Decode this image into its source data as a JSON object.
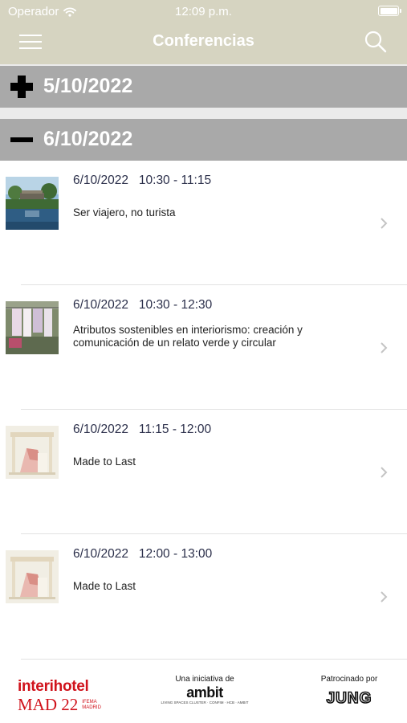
{
  "status_bar": {
    "carrier": "Operador",
    "time": "12:09 p.m."
  },
  "nav": {
    "title": "Conferencias"
  },
  "sections": [
    {
      "date": "5/10/2022",
      "state": "collapsed"
    },
    {
      "date": "6/10/2022",
      "state": "expanded"
    }
  ],
  "conferences": [
    {
      "date": "6/10/2022",
      "time": "10:30 - 11:15",
      "title": "Ser viajero, no turista",
      "thumb": "pool-photo"
    },
    {
      "date": "6/10/2022",
      "time": "10:30 - 12:30",
      "title": "Atributos sostenibles en interiorismo: creación y comunicación de un relato verde y circular",
      "thumb": "clothes-photo"
    },
    {
      "date": "6/10/2022",
      "time": "11:15 - 12:00",
      "title": "Made to Last",
      "thumb": "furniture-render"
    },
    {
      "date": "6/10/2022",
      "time": "12:00 - 13:00",
      "title": "Made to Last",
      "thumb": "furniture-render"
    }
  ],
  "footer": {
    "interihotel": {
      "line1": "interihotel",
      "line2": "MAD 22",
      "sub1": "IFEMA",
      "sub2": "MADRID"
    },
    "ambit": {
      "caption": "Una iniciativa de",
      "name": "ambit",
      "small": "LIVING SPACES CLUSTER · CONFIM · HCB · AMBIT"
    },
    "sponsor": {
      "caption": "Patrocinado por",
      "name": "JUNG"
    }
  },
  "colors": {
    "bar": "#d6d4c1",
    "section": "#a9a9a9",
    "date_text": "#2b2f4a",
    "brand_red": "#d0121b"
  }
}
